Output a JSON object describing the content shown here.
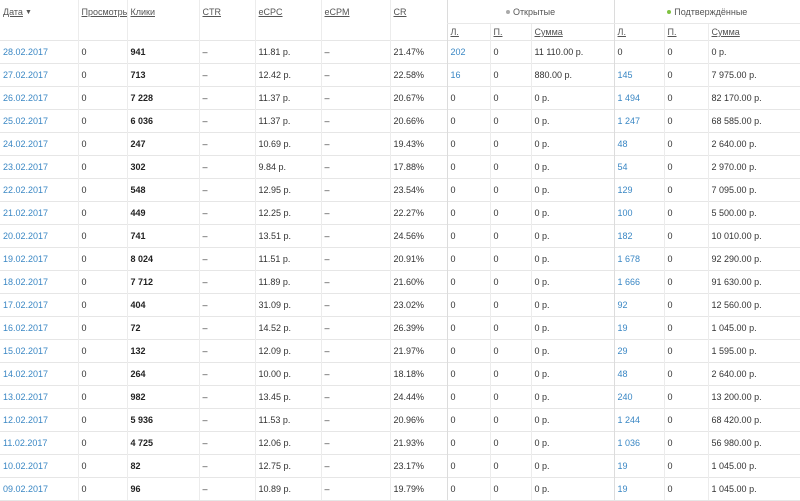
{
  "table": {
    "headers": {
      "date": "Дата",
      "views": "Просмотры",
      "clicks": "Клики",
      "ctr": "CTR",
      "ecpc": "eCPC",
      "ecpm": "eCPM",
      "cr": "CR",
      "group_open": "Открытые",
      "group_confirmed": "Подтверждённые",
      "sub_l": "Л.",
      "sub_p": "П.",
      "sub_sum": "Сумма"
    },
    "colors": {
      "link": "#3a87c4",
      "open_dot": "#aaaaaa",
      "confirmed_dot": "#7fc241"
    },
    "rows": [
      {
        "date": "28.02.2017",
        "views": "0",
        "clicks": "941",
        "ctr": "–",
        "ecpc": "11.81 р.",
        "ecpm": "–",
        "cr": "21.47%",
        "open_l": "202",
        "open_p": "0",
        "open_sum": "11 110.00 р.",
        "conf_l": "0",
        "conf_p": "0",
        "conf_sum": "0 р."
      },
      {
        "date": "27.02.2017",
        "views": "0",
        "clicks": "713",
        "ctr": "–",
        "ecpc": "12.42 р.",
        "ecpm": "–",
        "cr": "22.58%",
        "open_l": "16",
        "open_p": "0",
        "open_sum": "880.00 р.",
        "conf_l": "145",
        "conf_p": "0",
        "conf_sum": "7 975.00 р."
      },
      {
        "date": "26.02.2017",
        "views": "0",
        "clicks": "7 228",
        "ctr": "–",
        "ecpc": "11.37 р.",
        "ecpm": "–",
        "cr": "20.67%",
        "open_l": "0",
        "open_p": "0",
        "open_sum": "0 р.",
        "conf_l": "1 494",
        "conf_p": "0",
        "conf_sum": "82 170.00 р."
      },
      {
        "date": "25.02.2017",
        "views": "0",
        "clicks": "6 036",
        "ctr": "–",
        "ecpc": "11.37 р.",
        "ecpm": "–",
        "cr": "20.66%",
        "open_l": "0",
        "open_p": "0",
        "open_sum": "0 р.",
        "conf_l": "1 247",
        "conf_p": "0",
        "conf_sum": "68 585.00 р."
      },
      {
        "date": "24.02.2017",
        "views": "0",
        "clicks": "247",
        "ctr": "–",
        "ecpc": "10.69 р.",
        "ecpm": "–",
        "cr": "19.43%",
        "open_l": "0",
        "open_p": "0",
        "open_sum": "0 р.",
        "conf_l": "48",
        "conf_p": "0",
        "conf_sum": "2 640.00 р."
      },
      {
        "date": "23.02.2017",
        "views": "0",
        "clicks": "302",
        "ctr": "–",
        "ecpc": "9.84 р.",
        "ecpm": "–",
        "cr": "17.88%",
        "open_l": "0",
        "open_p": "0",
        "open_sum": "0 р.",
        "conf_l": "54",
        "conf_p": "0",
        "conf_sum": "2 970.00 р."
      },
      {
        "date": "22.02.2017",
        "views": "0",
        "clicks": "548",
        "ctr": "–",
        "ecpc": "12.95 р.",
        "ecpm": "–",
        "cr": "23.54%",
        "open_l": "0",
        "open_p": "0",
        "open_sum": "0 р.",
        "conf_l": "129",
        "conf_p": "0",
        "conf_sum": "7 095.00 р."
      },
      {
        "date": "21.02.2017",
        "views": "0",
        "clicks": "449",
        "ctr": "–",
        "ecpc": "12.25 р.",
        "ecpm": "–",
        "cr": "22.27%",
        "open_l": "0",
        "open_p": "0",
        "open_sum": "0 р.",
        "conf_l": "100",
        "conf_p": "0",
        "conf_sum": "5 500.00 р."
      },
      {
        "date": "20.02.2017",
        "views": "0",
        "clicks": "741",
        "ctr": "–",
        "ecpc": "13.51 р.",
        "ecpm": "–",
        "cr": "24.56%",
        "open_l": "0",
        "open_p": "0",
        "open_sum": "0 р.",
        "conf_l": "182",
        "conf_p": "0",
        "conf_sum": "10 010.00 р."
      },
      {
        "date": "19.02.2017",
        "views": "0",
        "clicks": "8 024",
        "ctr": "–",
        "ecpc": "11.51 р.",
        "ecpm": "–",
        "cr": "20.91%",
        "open_l": "0",
        "open_p": "0",
        "open_sum": "0 р.",
        "conf_l": "1 678",
        "conf_p": "0",
        "conf_sum": "92 290.00 р."
      },
      {
        "date": "18.02.2017",
        "views": "0",
        "clicks": "7 712",
        "ctr": "–",
        "ecpc": "11.89 р.",
        "ecpm": "–",
        "cr": "21.60%",
        "open_l": "0",
        "open_p": "0",
        "open_sum": "0 р.",
        "conf_l": "1 666",
        "conf_p": "0",
        "conf_sum": "91 630.00 р."
      },
      {
        "date": "17.02.2017",
        "views": "0",
        "clicks": "404",
        "ctr": "–",
        "ecpc": "31.09 р.",
        "ecpm": "–",
        "cr": "23.02%",
        "open_l": "0",
        "open_p": "0",
        "open_sum": "0 р.",
        "conf_l": "92",
        "conf_p": "0",
        "conf_sum": "12 560.00 р."
      },
      {
        "date": "16.02.2017",
        "views": "0",
        "clicks": "72",
        "ctr": "–",
        "ecpc": "14.52 р.",
        "ecpm": "–",
        "cr": "26.39%",
        "open_l": "0",
        "open_p": "0",
        "open_sum": "0 р.",
        "conf_l": "19",
        "conf_p": "0",
        "conf_sum": "1 045.00 р."
      },
      {
        "date": "15.02.2017",
        "views": "0",
        "clicks": "132",
        "ctr": "–",
        "ecpc": "12.09 р.",
        "ecpm": "–",
        "cr": "21.97%",
        "open_l": "0",
        "open_p": "0",
        "open_sum": "0 р.",
        "conf_l": "29",
        "conf_p": "0",
        "conf_sum": "1 595.00 р."
      },
      {
        "date": "14.02.2017",
        "views": "0",
        "clicks": "264",
        "ctr": "–",
        "ecpc": "10.00 р.",
        "ecpm": "–",
        "cr": "18.18%",
        "open_l": "0",
        "open_p": "0",
        "open_sum": "0 р.",
        "conf_l": "48",
        "conf_p": "0",
        "conf_sum": "2 640.00 р."
      },
      {
        "date": "13.02.2017",
        "views": "0",
        "clicks": "982",
        "ctr": "–",
        "ecpc": "13.45 р.",
        "ecpm": "–",
        "cr": "24.44%",
        "open_l": "0",
        "open_p": "0",
        "open_sum": "0 р.",
        "conf_l": "240",
        "conf_p": "0",
        "conf_sum": "13 200.00 р."
      },
      {
        "date": "12.02.2017",
        "views": "0",
        "clicks": "5 936",
        "ctr": "–",
        "ecpc": "11.53 р.",
        "ecpm": "–",
        "cr": "20.96%",
        "open_l": "0",
        "open_p": "0",
        "open_sum": "0 р.",
        "conf_l": "1 244",
        "conf_p": "0",
        "conf_sum": "68 420.00 р."
      },
      {
        "date": "11.02.2017",
        "views": "0",
        "clicks": "4 725",
        "ctr": "–",
        "ecpc": "12.06 р.",
        "ecpm": "–",
        "cr": "21.93%",
        "open_l": "0",
        "open_p": "0",
        "open_sum": "0 р.",
        "conf_l": "1 036",
        "conf_p": "0",
        "conf_sum": "56 980.00 р."
      },
      {
        "date": "10.02.2017",
        "views": "0",
        "clicks": "82",
        "ctr": "–",
        "ecpc": "12.75 р.",
        "ecpm": "–",
        "cr": "23.17%",
        "open_l": "0",
        "open_p": "0",
        "open_sum": "0 р.",
        "conf_l": "19",
        "conf_p": "0",
        "conf_sum": "1 045.00 р."
      },
      {
        "date": "09.02.2017",
        "views": "0",
        "clicks": "96",
        "ctr": "–",
        "ecpc": "10.89 р.",
        "ecpm": "–",
        "cr": "19.79%",
        "open_l": "0",
        "open_p": "0",
        "open_sum": "0 р.",
        "conf_l": "19",
        "conf_p": "0",
        "conf_sum": "1 045.00 р."
      }
    ]
  }
}
